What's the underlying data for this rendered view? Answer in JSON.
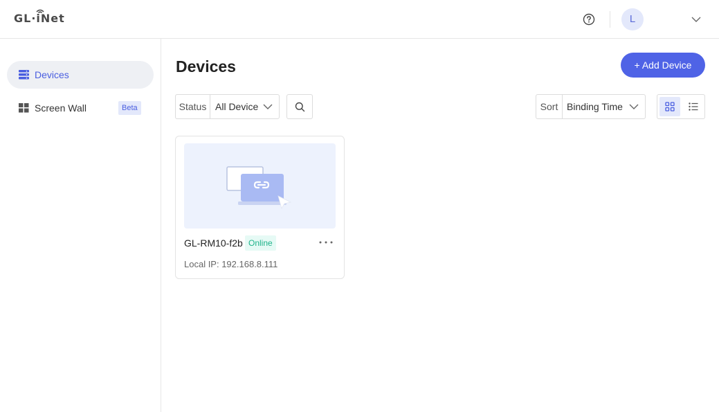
{
  "header": {
    "logo_text": "GL·iNet",
    "avatar_letter": "L"
  },
  "sidebar": {
    "items": [
      {
        "label": "Devices",
        "active": true,
        "icon": "devices-icon"
      },
      {
        "label": "Screen Wall",
        "active": false,
        "icon": "grid-icon",
        "badge": "Beta"
      }
    ]
  },
  "main": {
    "title": "Devices",
    "add_button": "+ Add Device",
    "status_filter": {
      "label": "Status",
      "value": "All Device"
    },
    "sort": {
      "label": "Sort",
      "value": "Binding Time"
    },
    "view_mode": "grid"
  },
  "devices": [
    {
      "name": "GL-RM10-f2b",
      "status": "Online",
      "local_ip": "Local IP: 192.168.8.111"
    }
  ],
  "colors": {
    "accent": "#4f63e6",
    "accent_light": "#e3e8fb",
    "online_text": "#1fb38a",
    "online_bg": "#e6faf5"
  }
}
